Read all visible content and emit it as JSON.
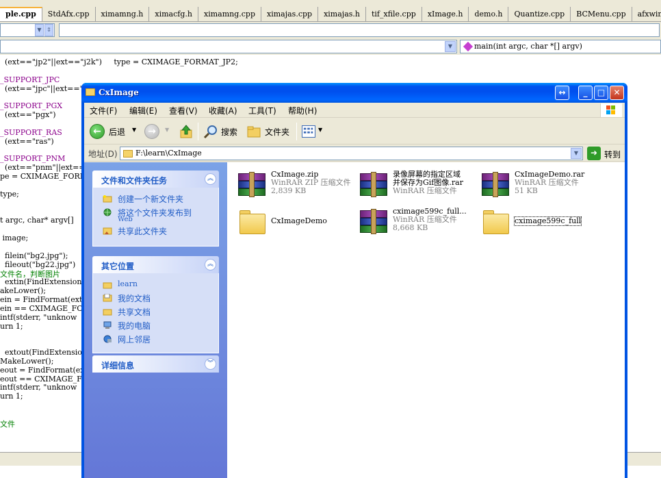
{
  "ide": {
    "tabs": [
      "ple.cpp",
      "StdAfx.cpp",
      "ximamng.h",
      "ximacfg.h",
      "ximamng.cpp",
      "ximajas.cpp",
      "ximajas.h",
      "tif_xfile.cpp",
      "xImage.h",
      "demo.h",
      "Quantize.cpp",
      "BCMenu.cpp",
      "afxwin.h"
    ],
    "active_tab": 0,
    "function_combo": "main(int argc, char *[] argv)",
    "code_lines": [
      "  (ext==\"jp2\"||ext==\"j2k\")     type = CXIMAGE_FORMAT_JP2;",
      "",
      "_SUPPORT_JPC",
      "  (ext==\"jpc\"||ext==\"j",
      "",
      "_SUPPORT_PGX",
      "  (ext==\"pgx\")",
      "",
      "_SUPPORT_RAS",
      "  (ext==\"ras\")",
      "",
      "_SUPPORT_PNM",
      "  (ext==\"pnm\"||ext==\"",
      "pe = CXIMAGE_FORMAT_",
      "",
      "type;",
      "",
      "",
      "t argc, char* argv[]",
      "",
      " image;",
      "",
      "  filein(\"bg2.jpg\");",
      "  fileout(\"bg22.jpg\")",
      "文件名，判断图片",
      "  extin(FindExtension",
      "akeLower();",
      "ein = FindFormat(ext",
      "ein == CXIMAGE_FORMA",
      "intf(stderr, \"unknow",
      "urn 1;",
      "",
      "",
      "  extout(FindExtensio",
      "MakeLower();",
      "eout = FindFormat(ex",
      "eout == CXIMAGE_FORM",
      "intf(stderr, \"unknow",
      "urn 1;",
      "",
      "",
      "文件"
    ]
  },
  "window": {
    "title": "CxImage",
    "menu": [
      "文件(F)",
      "编辑(E)",
      "查看(V)",
      "收藏(A)",
      "工具(T)",
      "帮助(H)"
    ],
    "toolbar": {
      "back_label": "后退",
      "search_label": "搜索",
      "folders_label": "文件夹"
    },
    "address": {
      "label": "地址(D)",
      "value": "F:\\learn\\CxImage",
      "go_label": "转到"
    },
    "taskpane": {
      "file_tasks": {
        "title": "文件和文件夹任务",
        "links": [
          "创建一个新文件夹",
          "将这个文件夹发布到",
          "Web",
          "共享此文件夹"
        ]
      },
      "other_places": {
        "title": "其它位置",
        "links": [
          "learn",
          "我的文档",
          "共享文档",
          "我的电脑",
          "网上邻居"
        ]
      },
      "details": {
        "title": "详细信息"
      }
    },
    "files": [
      {
        "name": "CxImage.zip",
        "line1": "WinRAR ZIP 压缩文件",
        "line2": "2,839 KB",
        "type": "rar"
      },
      {
        "name": "录像屏幕的指定区域",
        "name2": "并保存为Gif图像.rar",
        "line1": "WinRAR 压缩文件",
        "type": "rar"
      },
      {
        "name": "CxImageDemo.rar",
        "line1": "WinRAR 压缩文件",
        "line2": "51 KB",
        "type": "rar"
      },
      {
        "name": "CxImageDemo",
        "type": "folder"
      },
      {
        "name": "cximage599c_full...",
        "line1": "WinRAR 压缩文件",
        "line2": "8,668 KB",
        "type": "rar"
      },
      {
        "name": "cximage599c_full",
        "type": "folder",
        "selected": true
      }
    ]
  }
}
